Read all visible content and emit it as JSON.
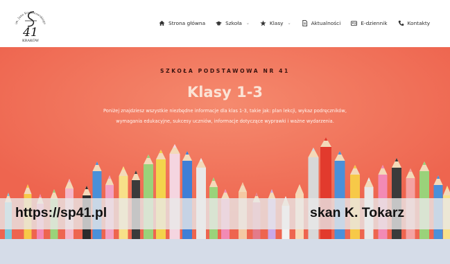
{
  "logo": {
    "arc_text": "im. Jana Kochanowskiego",
    "number": "41",
    "city": "KRAKÓW"
  },
  "nav": {
    "items": [
      {
        "label": "Strona główna",
        "icon": "home-icon"
      },
      {
        "label": "Szkoła",
        "icon": "graduation-cap-icon",
        "dropdown": true
      },
      {
        "label": "Klasy",
        "icon": "star-icon",
        "dropdown": true
      },
      {
        "label": "Aktualności",
        "icon": "document-icon"
      },
      {
        "label": "E-dziennik",
        "icon": "id-card-icon"
      },
      {
        "label": "Kontakty",
        "icon": "phone-icon"
      }
    ],
    "chevron": "⌄"
  },
  "hero": {
    "subtitle": "SZKOŁA PODSTAWOWA NR 41",
    "title": "Klasy 1-3",
    "description": "Poniżej znajdziesz wszystkie niezbędne informacje dla klas 1-3, takie jak: plan lekcji, wykaz podręczników, wymagania edukacyjne, sukcesy uczniów, informacje dotyczące wyprawki i ważne wydarzenia.",
    "background_color": "#f06c55"
  },
  "watermark": {
    "left": "https://sp41.pl",
    "right": "skan K. Tokarz"
  },
  "colors": {
    "hero": "#f06c55",
    "bottom_strip": "#d5dce8"
  }
}
